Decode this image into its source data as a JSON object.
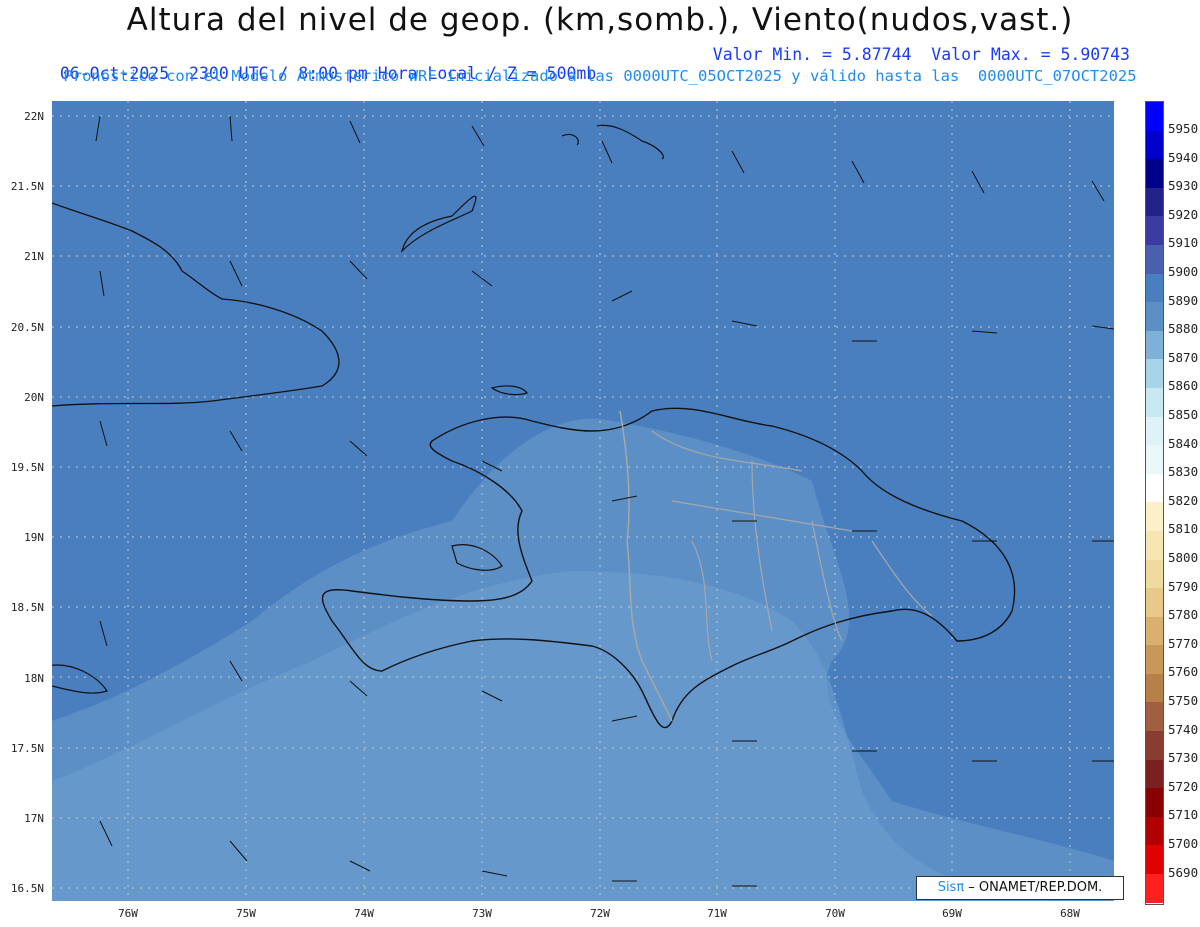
{
  "header": {
    "title": "Altura del nivel de geop. (km,somb.), Viento(nudos,vast.)",
    "subtitle_left": "06-Oct-2025  2300 UTC / 8:00 pm Hora Local / Z = 500mb",
    "subtitle_right": "Valor Min. = 5.87744  Valor Max. = 5.90743",
    "subtitle_line2": "Pronóstico con el Modelo Atmosferico WRF inicializado a las 0000UTC_05OCT2025 y válido hasta las  0000UTC_07OCT2025"
  },
  "map": {
    "lat_labels": [
      "22N",
      "21.5N",
      "21N",
      "20.5N",
      "20N",
      "19.5N",
      "19N",
      "18.5N",
      "18N",
      "17.5N",
      "17N",
      "16.5N"
    ],
    "lon_labels": [
      "76W",
      "75W",
      "74W",
      "73W",
      "72W",
      "71W",
      "70W",
      "69W",
      "68W"
    ],
    "colors": {
      "ocean": "#4a7fbf",
      "land_mid": "#5d8fc7",
      "land_light": "#6ea0cf",
      "coast": "#111111",
      "borders": "#a7a7a7",
      "grid": "#c8c8c8"
    }
  },
  "colorbar": {
    "levels": [
      "5950",
      "5940",
      "5930",
      "5920",
      "5910",
      "5900",
      "5890",
      "5880",
      "5870",
      "5860",
      "5850",
      "5840",
      "5830",
      "5820",
      "5810",
      "5800",
      "5790",
      "5780",
      "5770",
      "5760",
      "5750",
      "5740",
      "5730",
      "5720",
      "5710",
      "5700",
      "5690"
    ],
    "colors": [
      "#0000ff",
      "#0000cc",
      "#00008b",
      "#22228a",
      "#3a3aa0",
      "#4a5fb0",
      "#4a7fbf",
      "#5d8fc7",
      "#7fb0d8",
      "#a8d4ea",
      "#c8e8f2",
      "#dff2f8",
      "#eaf8fb",
      "#ffffff",
      "#fbf0c8",
      "#f5e6b4",
      "#efdaa0",
      "#e8c98a",
      "#d9b070",
      "#c99858",
      "#b78048",
      "#a06040",
      "#8a3c30",
      "#7a2020",
      "#8a0000",
      "#b00000",
      "#e00000",
      "#ff2020"
    ]
  },
  "credit": {
    "brand": "Sisπ",
    "text": " – ONAMET/REP.DOM."
  }
}
